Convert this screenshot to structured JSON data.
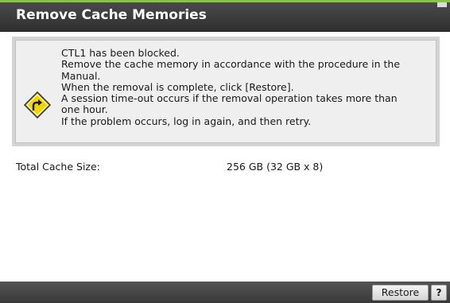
{
  "dialog": {
    "title": "Remove Cache Memories"
  },
  "message": {
    "icon": "warning-icon",
    "lines": [
      "CTL1 has been blocked.",
      "Remove the cache memory in accordance with the procedure in the",
      "Manual.",
      "When the removal is complete, click [Restore].",
      "A session time-out occurs if the removal operation takes more than",
      "one hour.",
      "If the problem occurs, log in again, and then retry."
    ]
  },
  "info": {
    "total_cache_label": "Total Cache Size:",
    "total_cache_value": "256 GB (32 GB x 8)"
  },
  "footer": {
    "restore_label": "Restore",
    "help_label": "?"
  },
  "colors": {
    "accent_green": "#8ac43f",
    "title_bar": "#3a3a3a",
    "warning_yellow": "#f2d400"
  }
}
